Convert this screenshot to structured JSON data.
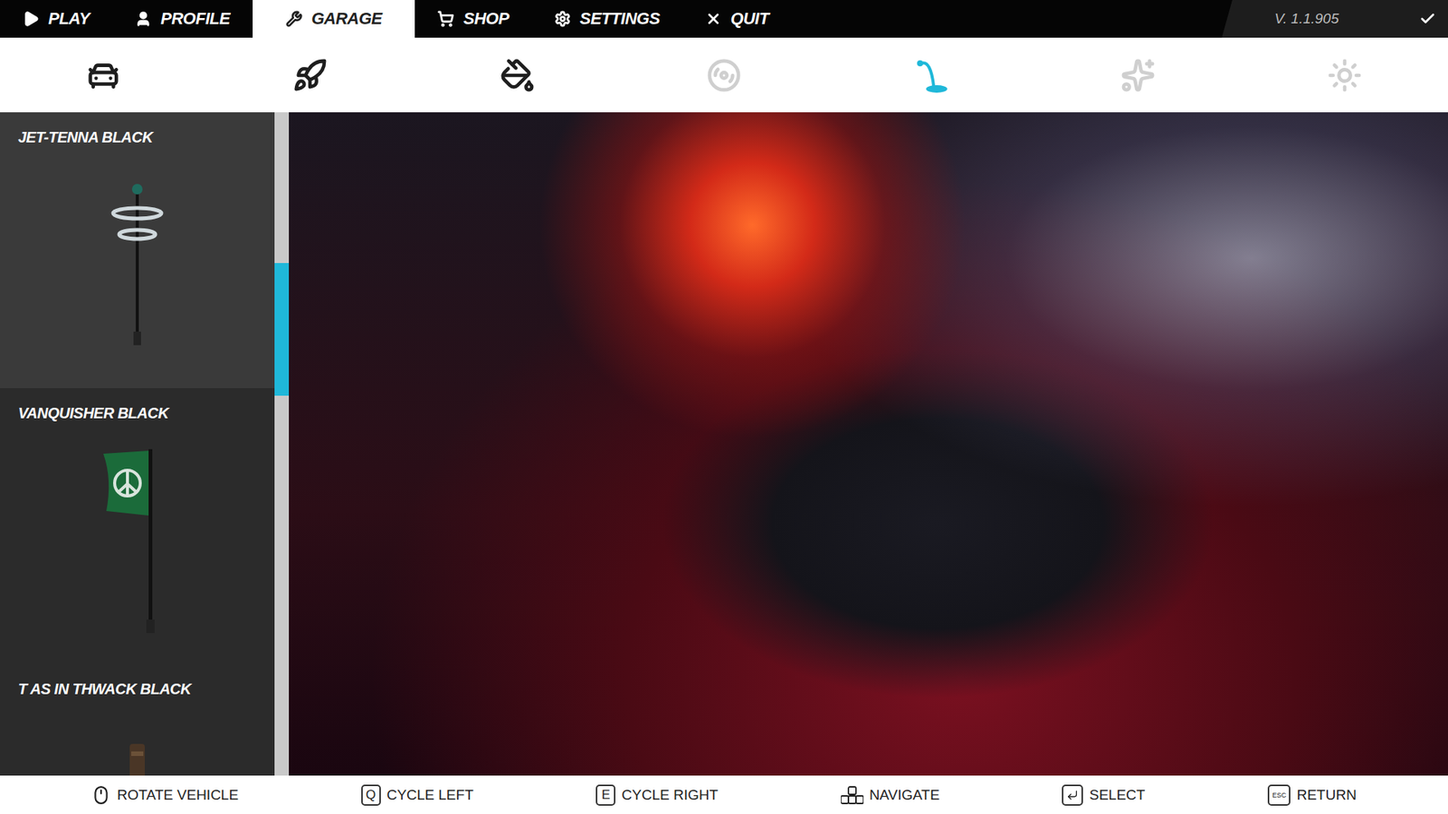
{
  "nav": {
    "items": [
      {
        "label": "PLAY",
        "kind": "play",
        "selected": false
      },
      {
        "label": "PROFILE",
        "kind": "profile",
        "selected": false
      },
      {
        "label": "GARAGE",
        "kind": "garage",
        "selected": true
      },
      {
        "label": "SHOP",
        "kind": "shop",
        "selected": false
      },
      {
        "label": "SETTINGS",
        "kind": "settings",
        "selected": false
      },
      {
        "label": "QUIT",
        "kind": "quit",
        "selected": false
      }
    ],
    "version": "V. 1.1.905",
    "version_ok": true
  },
  "categories": [
    {
      "kind": "chassis",
      "selected": false,
      "disabled": false
    },
    {
      "kind": "exhaust",
      "selected": false,
      "disabled": false
    },
    {
      "kind": "paint",
      "selected": false,
      "disabled": false
    },
    {
      "kind": "wheel",
      "selected": false,
      "disabled": true
    },
    {
      "kind": "antenna",
      "selected": true,
      "disabled": false
    },
    {
      "kind": "sparkle",
      "selected": false,
      "disabled": true
    },
    {
      "kind": "light",
      "selected": false,
      "disabled": true
    }
  ],
  "items": [
    {
      "name": "JET-TENNA BLACK",
      "kind": "antenna",
      "selected": true
    },
    {
      "name": "VANQUISHER BLACK",
      "kind": "flag",
      "selected": false
    },
    {
      "name": "T AS IN THWACK BLACK",
      "kind": "post",
      "selected": false
    }
  ],
  "scrollbar": {
    "offset": 0.227,
    "level": 0.2
  },
  "hints": [
    {
      "kind": "mouse",
      "key": "",
      "label": "ROTATE VEHICLE"
    },
    {
      "kind": "key",
      "key": "Q",
      "label": "CYCLE LEFT"
    },
    {
      "kind": "key",
      "key": "E",
      "label": "CYCLE RIGHT"
    },
    {
      "kind": "arrows",
      "key": "",
      "label": "NAVIGATE"
    },
    {
      "kind": "enter",
      "key": "",
      "label": "SELECT"
    },
    {
      "kind": "key",
      "key": "ESC",
      "label": "RETURN"
    }
  ]
}
